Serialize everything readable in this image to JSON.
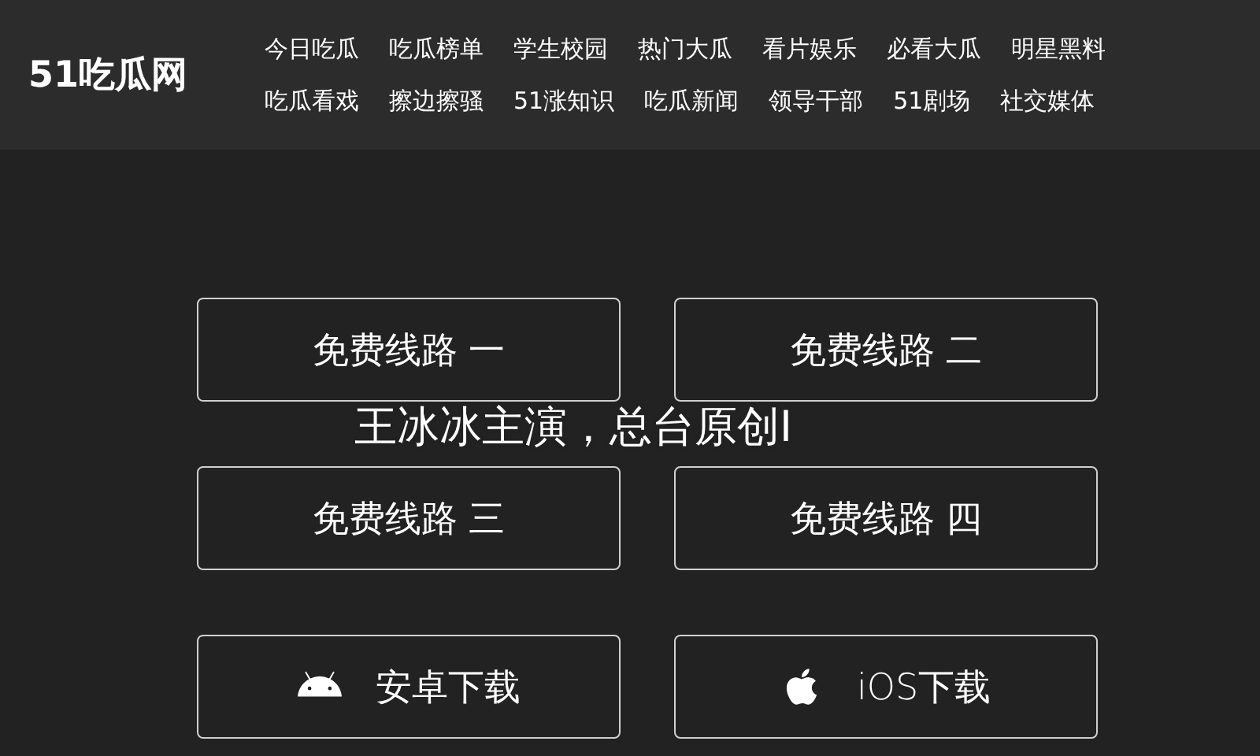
{
  "logo": "51吃瓜网",
  "nav_rows": [
    [
      "今日吃瓜",
      "吃瓜榜单",
      "学生校园",
      "热门大瓜",
      "看片娱乐",
      "必看大瓜",
      "明星黑料"
    ],
    [
      "吃瓜看戏",
      "擦边擦骚",
      "51涨知识",
      "吃瓜新闻",
      "领导干部",
      "51剧场",
      "社交媒体"
    ]
  ],
  "buttons": [
    {
      "label": "免费线路 一",
      "kind": "line"
    },
    {
      "label": "免费线路 二",
      "kind": "line"
    },
    {
      "label": "免费线路 三",
      "kind": "line"
    },
    {
      "label": "免费线路 四",
      "kind": "line"
    },
    {
      "label": "安卓下载",
      "kind": "android"
    },
    {
      "label": "iOS下载",
      "kind": "ios"
    }
  ],
  "overlay_text": "王冰冰主演，总台原创I"
}
